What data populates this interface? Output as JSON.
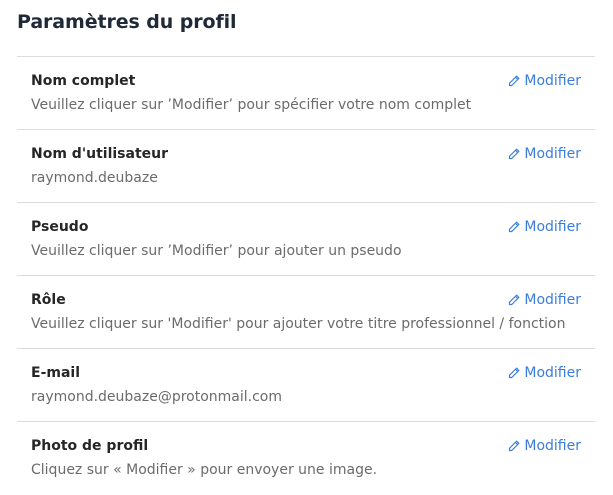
{
  "header": {
    "title": "Paramètres du profil"
  },
  "colors": {
    "accent": "#3b7ddd",
    "divider": "#dcdcdc",
    "muted": "#6b6b6b"
  },
  "edit_icon": "pencil-icon",
  "fields": [
    {
      "label": "Nom complet",
      "value": "Veuillez cliquer sur ’Modifier’ pour spécifier votre nom complet",
      "action": "Modifier"
    },
    {
      "label": "Nom d'utilisateur",
      "value": "raymond.deubaze",
      "action": "Modifier"
    },
    {
      "label": "Pseudo",
      "value": "Veuillez cliquer sur ’Modifier’ pour ajouter un pseudo",
      "action": "Modifier"
    },
    {
      "label": "Rôle",
      "value": "Veuillez cliquer sur 'Modifier' pour ajouter votre titre professionnel / fonction",
      "action": "Modifier"
    },
    {
      "label": "E-mail",
      "value": "raymond.deubaze@protonmail.com",
      "action": "Modifier"
    },
    {
      "label": "Photo de profil",
      "value": "Cliquez sur « Modifier » pour envoyer une image.",
      "action": "Modifier"
    }
  ]
}
